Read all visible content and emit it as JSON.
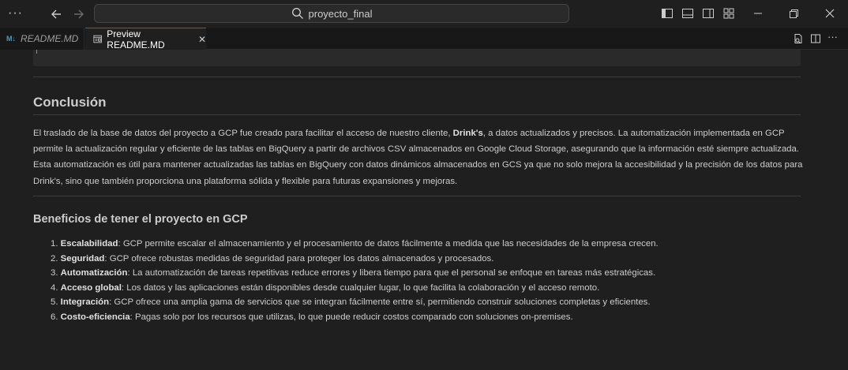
{
  "titlebar": {
    "search_text": "proyecto_final"
  },
  "tabs": [
    {
      "label": "README.MD",
      "icon": "markdown-icon"
    },
    {
      "label": "Preview README.MD",
      "icon": "preview-icon"
    }
  ],
  "doc": {
    "h2": "Conclusión",
    "para_1": "El traslado de la base de datos del proyecto a GCP fue creado para facilitar el acceso de nuestro cliente, ",
    "para_bold": "Drink's",
    "para_2": ", a datos actualizados y precisos. La automatización implementada en GCP permite la actualización regular y eficiente de las tablas en BigQuery a partir de archivos CSV almacenados en Google Cloud Storage, asegurando que la información esté siempre actualizada. Esta automatización es útil para mantener actualizadas las tablas en BigQuery con datos dinámicos almacenados en GCS ya que no solo mejora la accesibilidad y la precisión de los datos para Drink's, sino que también proporciona una plataforma sólida y flexible para futuras expansiones y mejoras.",
    "h3": "Beneficios de tener el proyecto en GCP",
    "items": [
      {
        "num": "1.",
        "title": "Escalabilidad",
        "text": ": GCP permite escalar el almacenamiento y el procesamiento de datos fácilmente a medida que las necesidades de la empresa crecen."
      },
      {
        "num": "2.",
        "title": "Seguridad",
        "text": ": GCP ofrece robustas medidas de seguridad para proteger los datos almacenados y procesados."
      },
      {
        "num": "3.",
        "title": "Automatización",
        "text": ": La automatización de tareas repetitivas reduce errores y libera tiempo para que el personal se enfoque en tareas más estratégicas."
      },
      {
        "num": "4.",
        "title": "Acceso global",
        "text": ": Los datos y las aplicaciones están disponibles desde cualquier lugar, lo que facilita la colaboración y el acceso remoto."
      },
      {
        "num": "5.",
        "title": "Integración",
        "text": ": GCP ofrece una amplia gama de servicios que se integran fácilmente entre sí, permitiendo construir soluciones completas y eficientes."
      },
      {
        "num": "6.",
        "title": "Costo-eficiencia",
        "text": ": Pagas solo por los recursos que utilizas, lo que puede reducir costos comparado con soluciones on-premises."
      }
    ]
  }
}
